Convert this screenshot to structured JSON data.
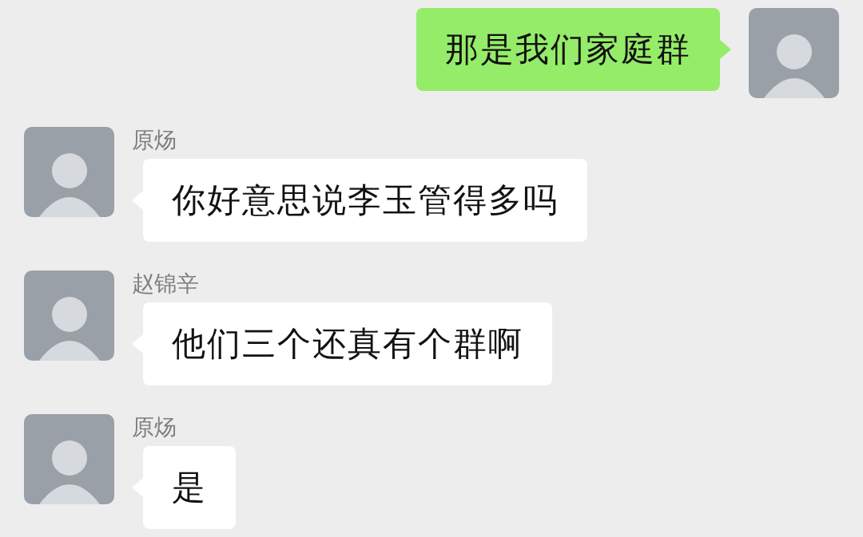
{
  "messages": [
    {
      "kind": "sent",
      "text": "那是我们家庭群"
    },
    {
      "kind": "received",
      "sender": "原炀",
      "text": "你好意思说李玉管得多吗"
    },
    {
      "kind": "received",
      "sender": "赵锦辛",
      "text": "他们三个还真有个群啊"
    },
    {
      "kind": "received",
      "sender": "原炀",
      "text": "是"
    }
  ]
}
